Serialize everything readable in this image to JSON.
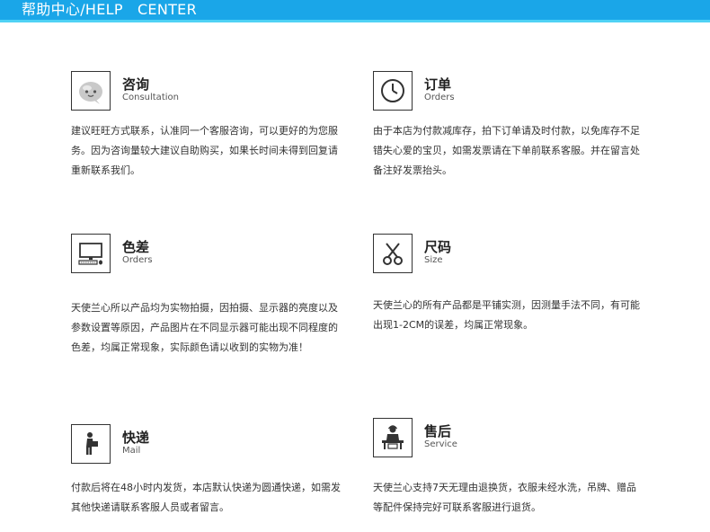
{
  "header": {
    "title": "帮助中心/HELP   CENTER"
  },
  "colors": {
    "header_bg": "#1aa6e8",
    "header_accent": "#4fd2f5",
    "text": "#333333"
  },
  "sections": [
    {
      "icon": "chat-bubble-icon",
      "title": "咨询",
      "subtitle": "Consultation",
      "text": "建议旺旺方式联系，认准同一个客服咨询，可以更好的为您服务。因为咨询量较大建议自助购买，如果长时间未得到回复请重新联系我们。"
    },
    {
      "icon": "clock-icon",
      "title": "订单",
      "subtitle": "Orders",
      "text": "由于本店为付款减库存，拍下订单请及时付款，以免库存不足错失心爱的宝贝，如需发票请在下单前联系客服。并在留言处备注好发票抬头。"
    },
    {
      "icon": "computer-icon",
      "title": "色差",
      "subtitle": "Orders",
      "text": "天使兰心所以产品均为实物拍摄，因拍摄、显示器的亮度以及参数设置等原因，产品图片在不同显示器可能出现不同程度的色差，均属正常现象，实际颜色请以收到的实物为准！"
    },
    {
      "icon": "scissors-icon",
      "title": "尺码",
      "subtitle": "Size",
      "text": "天使兰心的所有产品都是平铺实测，因测量手法不同，有可能出现1-2CM的误差，均属正常现象。"
    },
    {
      "icon": "courier-icon",
      "title": "快递",
      "subtitle": "Mail",
      "text": "付款后将在48小时内发货，本店默认快递为圆通快递，如需发其他快递请联系客服人员或者留言。"
    },
    {
      "icon": "service-desk-icon",
      "title": "售后",
      "subtitle": "Service",
      "text": "天使兰心支持7天无理由退换货，衣服未经水洗，吊牌、赠品等配件保持完好可联系客服进行退货。"
    }
  ]
}
